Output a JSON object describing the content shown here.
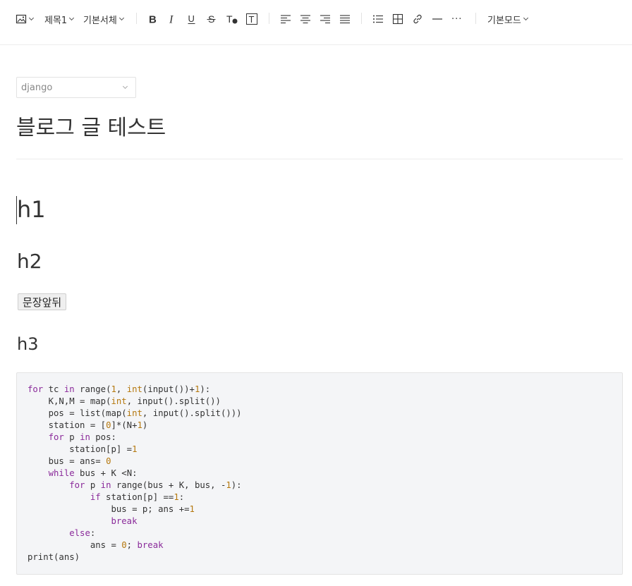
{
  "toolbar": {
    "image_label": "",
    "heading_select": "제목1",
    "font_select": "기본서체",
    "mode_select": "기본모드",
    "more": "···"
  },
  "category": {
    "selected": "django"
  },
  "post": {
    "title": "블로그 글 테스트"
  },
  "content": {
    "h1": "h1",
    "h2": "h2",
    "inline_button": "문장앞뒤",
    "h3": "h3"
  },
  "code": {
    "language": "python",
    "lines": [
      "for tc in range(1, int(input())+1):",
      "    K,N,M = map(int, input().split())",
      "    pos = list(map(int, input().split()))",
      "    station = [0]*(N+1)",
      "    for p in pos:",
      "        station[p] =1",
      "    bus = ans= 0",
      "    while bus + K <N:",
      "        for p in range(bus + K, bus, -1):",
      "            if station[p] ==1:",
      "                bus = p; ans +=1",
      "                break",
      "        else:",
      "            ans = 0; break",
      "print(ans)"
    ]
  },
  "colors": {
    "keyword": "#8a2a9a",
    "number": "#b5780e",
    "code_bg": "#f4f5f7"
  }
}
